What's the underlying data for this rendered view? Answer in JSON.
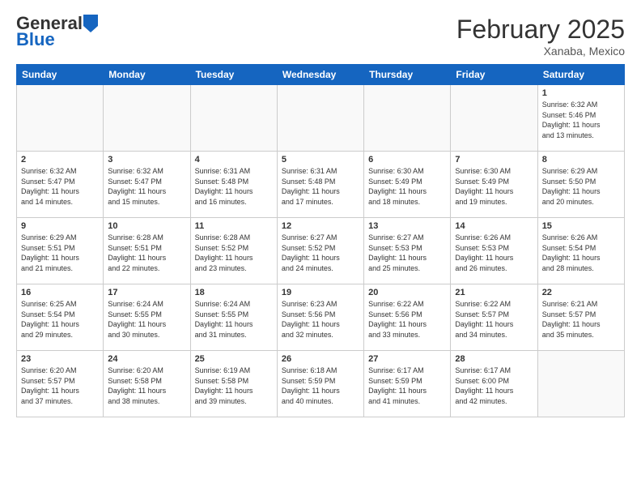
{
  "header": {
    "logo_general": "General",
    "logo_blue": "Blue",
    "month_title": "February 2025",
    "location": "Xanaba, Mexico"
  },
  "weekdays": [
    "Sunday",
    "Monday",
    "Tuesday",
    "Wednesday",
    "Thursday",
    "Friday",
    "Saturday"
  ],
  "weeks": [
    [
      {
        "day": "",
        "info": ""
      },
      {
        "day": "",
        "info": ""
      },
      {
        "day": "",
        "info": ""
      },
      {
        "day": "",
        "info": ""
      },
      {
        "day": "",
        "info": ""
      },
      {
        "day": "",
        "info": ""
      },
      {
        "day": "1",
        "info": "Sunrise: 6:32 AM\nSunset: 5:46 PM\nDaylight: 11 hours\nand 13 minutes."
      }
    ],
    [
      {
        "day": "2",
        "info": "Sunrise: 6:32 AM\nSunset: 5:47 PM\nDaylight: 11 hours\nand 14 minutes."
      },
      {
        "day": "3",
        "info": "Sunrise: 6:32 AM\nSunset: 5:47 PM\nDaylight: 11 hours\nand 15 minutes."
      },
      {
        "day": "4",
        "info": "Sunrise: 6:31 AM\nSunset: 5:48 PM\nDaylight: 11 hours\nand 16 minutes."
      },
      {
        "day": "5",
        "info": "Sunrise: 6:31 AM\nSunset: 5:48 PM\nDaylight: 11 hours\nand 17 minutes."
      },
      {
        "day": "6",
        "info": "Sunrise: 6:30 AM\nSunset: 5:49 PM\nDaylight: 11 hours\nand 18 minutes."
      },
      {
        "day": "7",
        "info": "Sunrise: 6:30 AM\nSunset: 5:49 PM\nDaylight: 11 hours\nand 19 minutes."
      },
      {
        "day": "8",
        "info": "Sunrise: 6:29 AM\nSunset: 5:50 PM\nDaylight: 11 hours\nand 20 minutes."
      }
    ],
    [
      {
        "day": "9",
        "info": "Sunrise: 6:29 AM\nSunset: 5:51 PM\nDaylight: 11 hours\nand 21 minutes."
      },
      {
        "day": "10",
        "info": "Sunrise: 6:28 AM\nSunset: 5:51 PM\nDaylight: 11 hours\nand 22 minutes."
      },
      {
        "day": "11",
        "info": "Sunrise: 6:28 AM\nSunset: 5:52 PM\nDaylight: 11 hours\nand 23 minutes."
      },
      {
        "day": "12",
        "info": "Sunrise: 6:27 AM\nSunset: 5:52 PM\nDaylight: 11 hours\nand 24 minutes."
      },
      {
        "day": "13",
        "info": "Sunrise: 6:27 AM\nSunset: 5:53 PM\nDaylight: 11 hours\nand 25 minutes."
      },
      {
        "day": "14",
        "info": "Sunrise: 6:26 AM\nSunset: 5:53 PM\nDaylight: 11 hours\nand 26 minutes."
      },
      {
        "day": "15",
        "info": "Sunrise: 6:26 AM\nSunset: 5:54 PM\nDaylight: 11 hours\nand 28 minutes."
      }
    ],
    [
      {
        "day": "16",
        "info": "Sunrise: 6:25 AM\nSunset: 5:54 PM\nDaylight: 11 hours\nand 29 minutes."
      },
      {
        "day": "17",
        "info": "Sunrise: 6:24 AM\nSunset: 5:55 PM\nDaylight: 11 hours\nand 30 minutes."
      },
      {
        "day": "18",
        "info": "Sunrise: 6:24 AM\nSunset: 5:55 PM\nDaylight: 11 hours\nand 31 minutes."
      },
      {
        "day": "19",
        "info": "Sunrise: 6:23 AM\nSunset: 5:56 PM\nDaylight: 11 hours\nand 32 minutes."
      },
      {
        "day": "20",
        "info": "Sunrise: 6:22 AM\nSunset: 5:56 PM\nDaylight: 11 hours\nand 33 minutes."
      },
      {
        "day": "21",
        "info": "Sunrise: 6:22 AM\nSunset: 5:57 PM\nDaylight: 11 hours\nand 34 minutes."
      },
      {
        "day": "22",
        "info": "Sunrise: 6:21 AM\nSunset: 5:57 PM\nDaylight: 11 hours\nand 35 minutes."
      }
    ],
    [
      {
        "day": "23",
        "info": "Sunrise: 6:20 AM\nSunset: 5:57 PM\nDaylight: 11 hours\nand 37 minutes."
      },
      {
        "day": "24",
        "info": "Sunrise: 6:20 AM\nSunset: 5:58 PM\nDaylight: 11 hours\nand 38 minutes."
      },
      {
        "day": "25",
        "info": "Sunrise: 6:19 AM\nSunset: 5:58 PM\nDaylight: 11 hours\nand 39 minutes."
      },
      {
        "day": "26",
        "info": "Sunrise: 6:18 AM\nSunset: 5:59 PM\nDaylight: 11 hours\nand 40 minutes."
      },
      {
        "day": "27",
        "info": "Sunrise: 6:17 AM\nSunset: 5:59 PM\nDaylight: 11 hours\nand 41 minutes."
      },
      {
        "day": "28",
        "info": "Sunrise: 6:17 AM\nSunset: 6:00 PM\nDaylight: 11 hours\nand 42 minutes."
      },
      {
        "day": "",
        "info": ""
      }
    ]
  ]
}
